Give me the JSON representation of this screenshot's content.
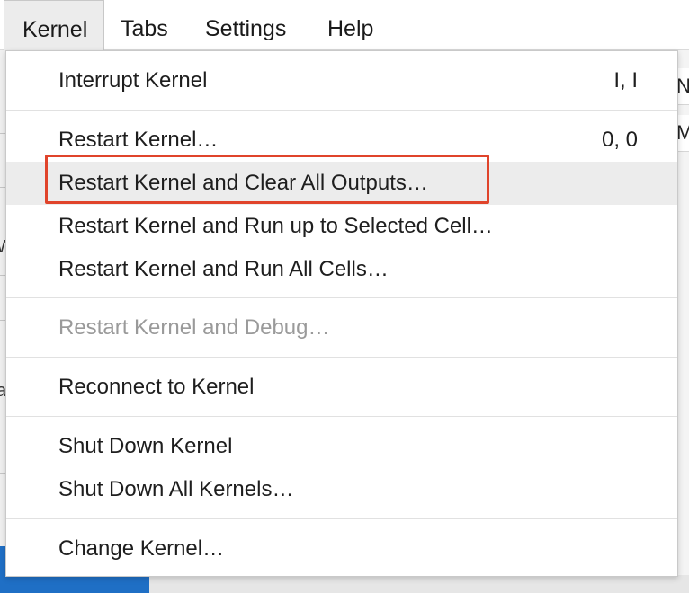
{
  "menubar": {
    "items": [
      {
        "label": "Kernel"
      },
      {
        "label": "Tabs"
      },
      {
        "label": "Settings"
      },
      {
        "label": "Help"
      }
    ]
  },
  "background": {
    "right_row1": "N.",
    "right_row2": "M",
    "left_glyph1": "W",
    "left_glyph2": "a",
    "bottom_blue": "#1f6fc5"
  },
  "kernel_menu": {
    "interrupt": {
      "label": "Interrupt Kernel",
      "shortcut": "I, I"
    },
    "restart": {
      "label": "Restart Kernel…",
      "shortcut": "0, 0"
    },
    "restart_clear": {
      "label": "Restart Kernel and Clear All Outputs…"
    },
    "restart_run_selected": {
      "label": "Restart Kernel and Run up to Selected Cell…"
    },
    "restart_run_all": {
      "label": "Restart Kernel and Run All Cells…"
    },
    "restart_debug": {
      "label": "Restart Kernel and Debug…",
      "disabled": true
    },
    "reconnect": {
      "label": "Reconnect to Kernel"
    },
    "shutdown": {
      "label": "Shut Down Kernel"
    },
    "shutdown_all": {
      "label": "Shut Down All Kernels…"
    },
    "change_kernel": {
      "label": "Change Kernel…"
    }
  },
  "colors": {
    "highlight_border": "#e0442b",
    "hover_background": "#ececec",
    "disabled_text": "#9a9a9a"
  }
}
